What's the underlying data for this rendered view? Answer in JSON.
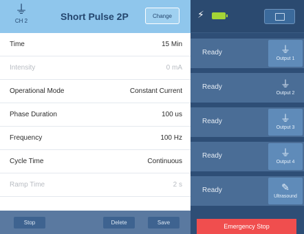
{
  "header": {
    "channel_label": "CH 2",
    "program_title": "Short Pulse 2P",
    "change_label": "Change"
  },
  "parameters": [
    {
      "label": "Time",
      "value": "15 Min",
      "enabled": true
    },
    {
      "label": "Intensity",
      "value": "0 mA",
      "enabled": false
    },
    {
      "label": "Operational Mode",
      "value": "Constant Current",
      "enabled": true
    },
    {
      "label": "Phase Duration",
      "value": "100 us",
      "enabled": true
    },
    {
      "label": "Frequency",
      "value": "100 Hz",
      "enabled": true
    },
    {
      "label": "Cycle Time",
      "value": "Continuous",
      "enabled": true
    },
    {
      "label": "Ramp Time",
      "value": "2 s",
      "enabled": false
    }
  ],
  "footer": {
    "btn1": "Stop",
    "btn2": "Delete",
    "btn3": "Save"
  },
  "outputs": [
    {
      "status": "Ready",
      "label": "Output 1",
      "icon": "plug-icon"
    },
    {
      "status": "Ready",
      "label": "Output 2",
      "icon": "plug-icon"
    },
    {
      "status": "Ready",
      "label": "Output 3",
      "icon": "plug-icon"
    },
    {
      "status": "Ready",
      "label": "Output 4",
      "icon": "plug-icon"
    },
    {
      "status": "Ready",
      "label": "Ultrasound",
      "icon": "ultrasound-probe-icon"
    }
  ],
  "emergency_stop_label": "Emergency Stop",
  "colors": {
    "header_bg": "#8fc6ec",
    "panel_bg": "#2e4e76",
    "battery": "#a4d436",
    "emergency": "#f04e4e"
  }
}
